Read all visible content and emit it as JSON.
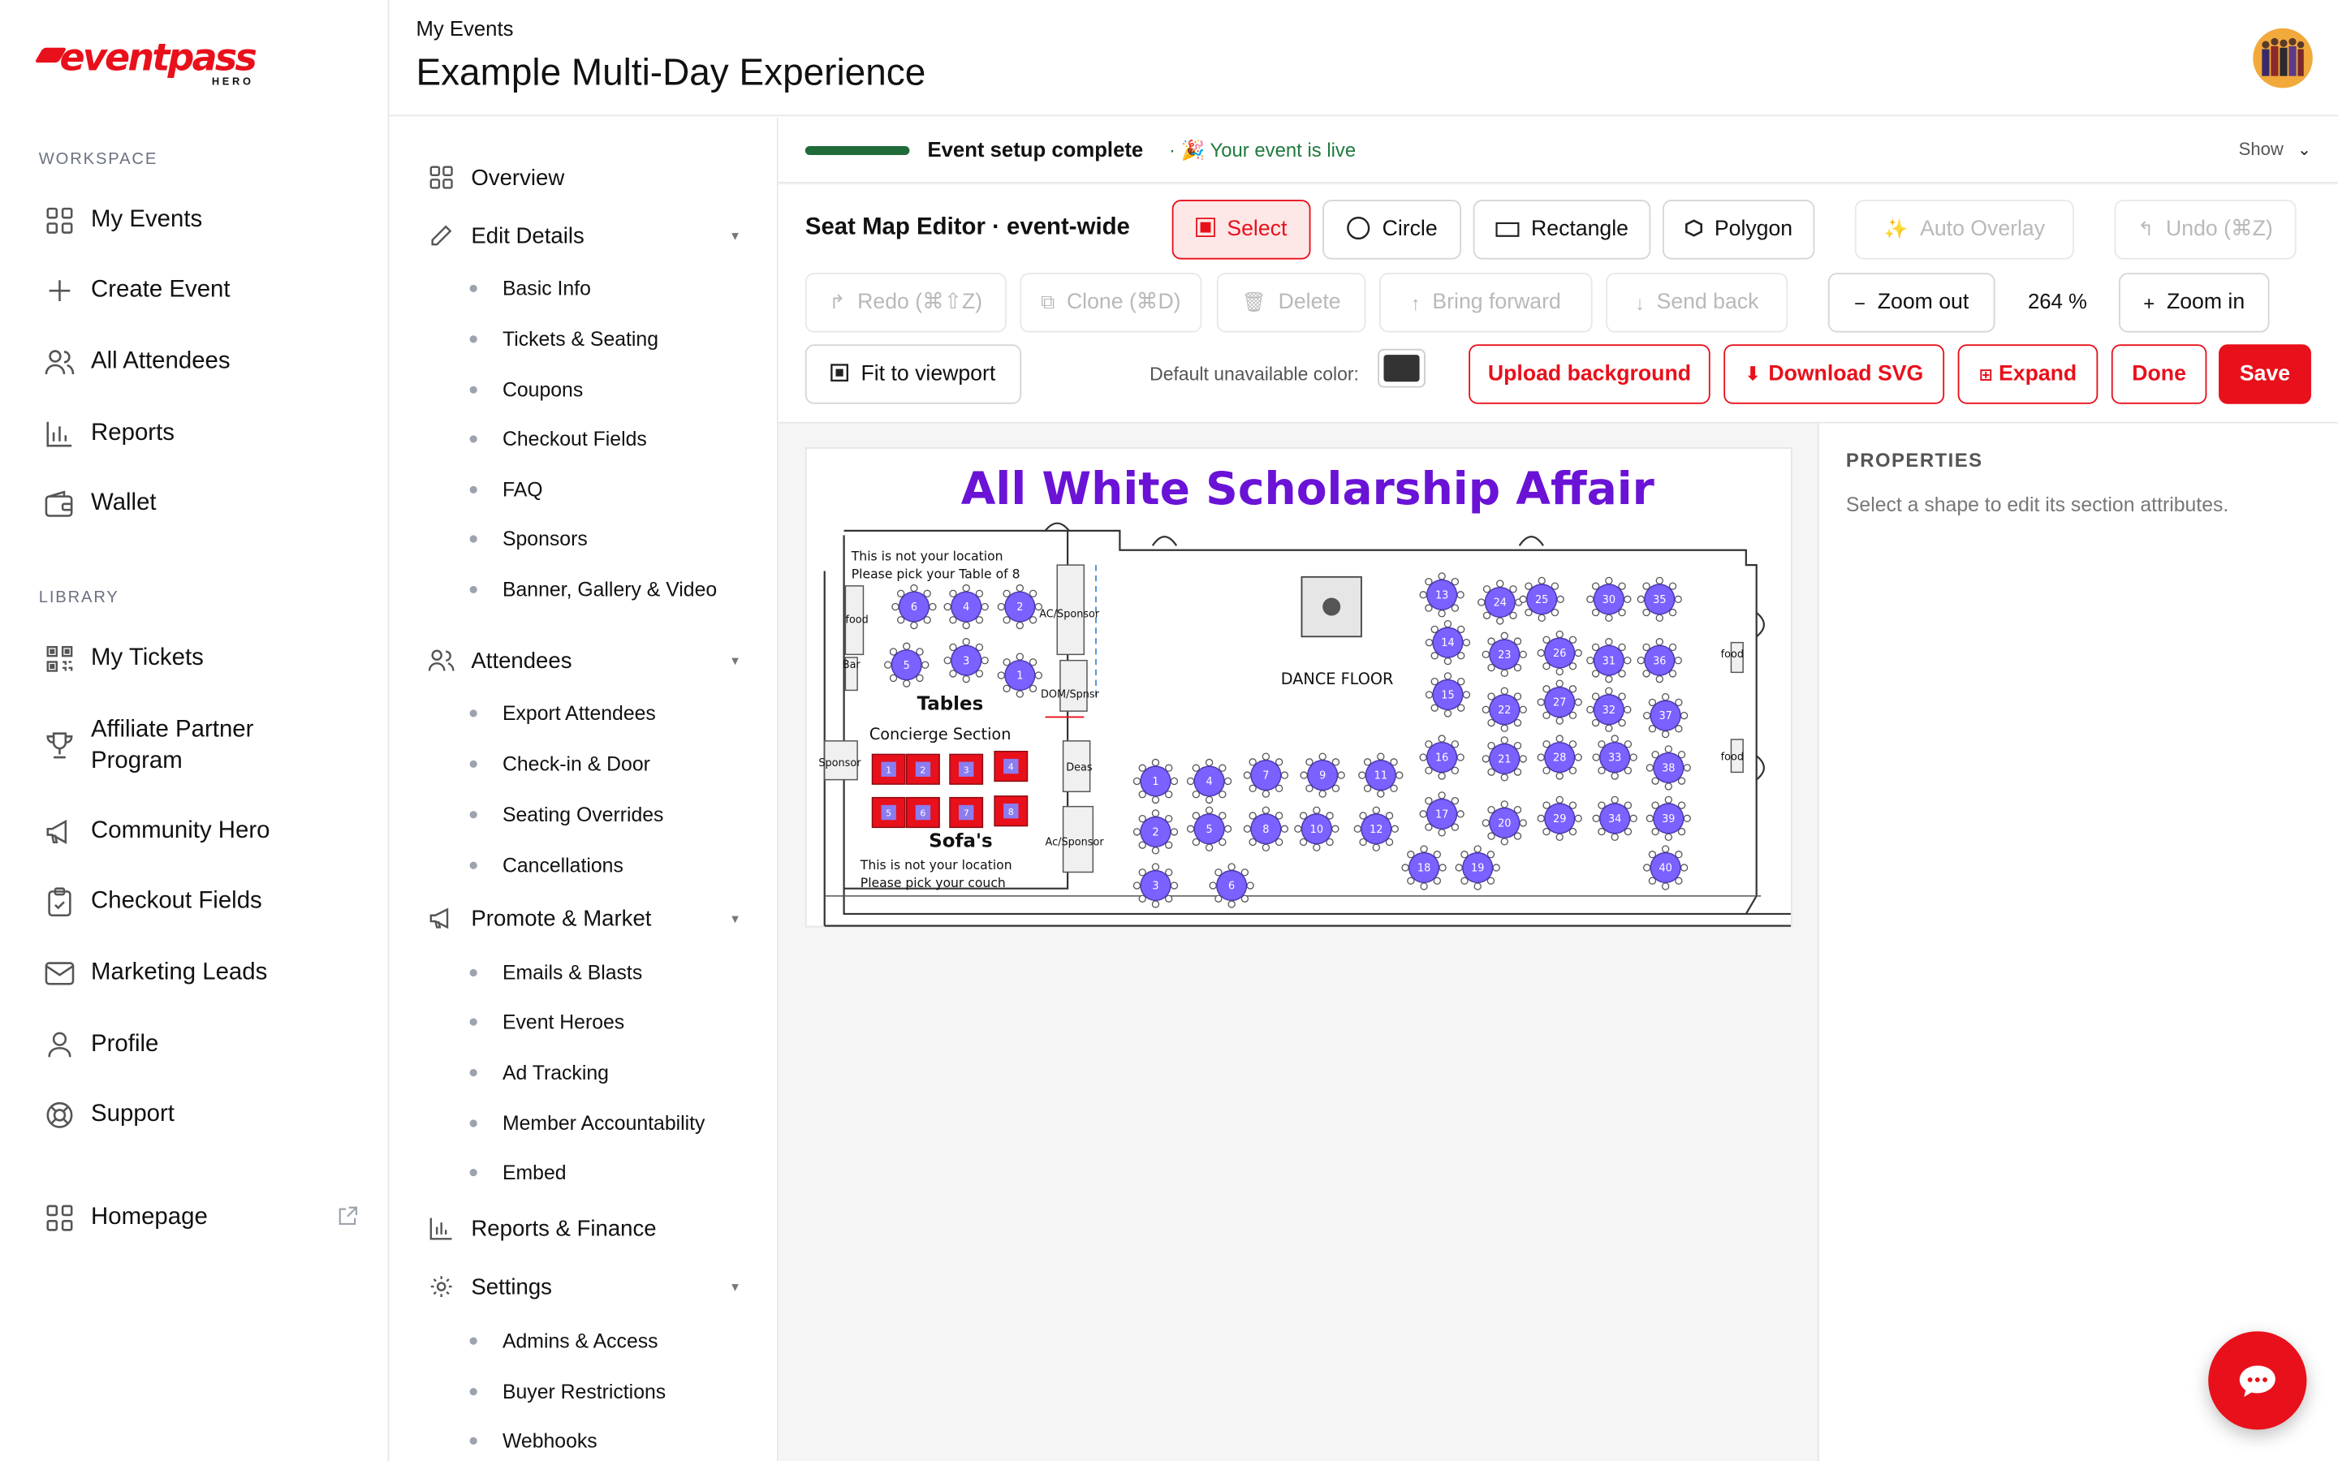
{
  "brand": {
    "logo_text": "eventpass",
    "logo_sub": "HERO",
    "accent": "#e8101b"
  },
  "sidebar": {
    "workspace_label": "WORKSPACE",
    "library_label": "LIBRARY",
    "workspace_items": [
      {
        "label": "My Events",
        "icon": "grid-icon"
      },
      {
        "label": "Create Event",
        "icon": "plus-icon"
      },
      {
        "label": "All Attendees",
        "icon": "users-icon"
      },
      {
        "label": "Reports",
        "icon": "bar-chart-icon"
      },
      {
        "label": "Wallet",
        "icon": "wallet-icon"
      }
    ],
    "library_items": [
      {
        "label": "My Tickets",
        "icon": "qr-code-icon"
      },
      {
        "label": "Affiliate Partner Program",
        "icon": "trophy-icon"
      },
      {
        "label": "Community Hero",
        "icon": "megaphone-icon"
      },
      {
        "label": "Checkout Fields",
        "icon": "clipboard-icon"
      },
      {
        "label": "Marketing Leads",
        "icon": "mail-icon"
      },
      {
        "label": "Profile",
        "icon": "user-icon"
      },
      {
        "label": "Support",
        "icon": "lifebuoy-icon"
      }
    ],
    "homepage": {
      "label": "Homepage",
      "icon": "grid-icon"
    }
  },
  "header": {
    "breadcrumb": "My Events",
    "title": "Example Multi-Day Experience"
  },
  "subnav": {
    "overview": "Overview",
    "edit_details": "Edit Details",
    "edit_items": [
      "Basic Info",
      "Tickets & Seating",
      "Coupons",
      "Checkout Fields",
      "FAQ",
      "Sponsors",
      "Banner, Gallery & Video"
    ],
    "attendees": "Attendees",
    "attendee_items": [
      "Export Attendees",
      "Check-in & Door",
      "Seating Overrides",
      "Cancellations"
    ],
    "promote": "Promote & Market",
    "promote_items": [
      "Emails & Blasts",
      "Event Heroes",
      "Ad Tracking",
      "Member Accountability",
      "Embed"
    ],
    "reports": "Reports & Finance",
    "settings": "Settings",
    "settings_items": [
      "Admins & Access",
      "Buyer Restrictions",
      "Webhooks"
    ]
  },
  "status": {
    "complete": "Event setup complete",
    "live": "· 🎉 Your event is live",
    "show": "Show"
  },
  "toolbar": {
    "title": "Seat Map Editor · event-wide",
    "select": "Select",
    "circle": "Circle",
    "rectangle": "Rectangle",
    "polygon": "Polygon",
    "auto_overlay": "Auto Overlay",
    "undo": "Undo (⌘Z)",
    "redo": "Redo (⌘⇧Z)",
    "clone": "Clone (⌘D)",
    "delete": "Delete",
    "bring_forward": "Bring forward",
    "send_back": "Send back",
    "zoom_out": "Zoom out",
    "zoom_value": "264  %",
    "zoom_in": "Zoom in",
    "fit": "Fit to viewport",
    "default_color_label": "Default unavailable color:",
    "default_color": "#333333",
    "upload_bg": "Upload background",
    "download_svg": "Download SVG",
    "expand": "Expand",
    "done": "Done",
    "save": "Save"
  },
  "seatmap": {
    "title": "All White Scholarship Affair",
    "note_top_line1": "This is not your location",
    "note_top_line2": "Please pick your Table of 8",
    "tables_label": "Tables",
    "concierge_label": "Concierge Section",
    "sofas_label": "Sofa's",
    "note_bottom_line1": "This is not your location",
    "note_bottom_line2": "Please pick your couch",
    "dance_floor": "DANCE FLOOR",
    "food": "food",
    "bar": "Bar",
    "sponsor": "Sponsor",
    "ac_sponsor_top": "AC/Sponsor",
    "dom_sponsor": "DOM/Spnsr",
    "deas": "Deas",
    "ac_sponsor_bottom": "Ac/Sponsor",
    "left_tables": [
      {
        "n": "6"
      },
      {
        "n": "4"
      },
      {
        "n": "2"
      },
      {
        "n": "5"
      },
      {
        "n": "3"
      },
      {
        "n": "1"
      }
    ],
    "tables": [
      {
        "n": "13"
      },
      {
        "n": "24"
      },
      {
        "n": "25"
      },
      {
        "n": "30"
      },
      {
        "n": "35"
      },
      {
        "n": "14"
      },
      {
        "n": "23"
      },
      {
        "n": "26"
      },
      {
        "n": "31"
      },
      {
        "n": "36"
      },
      {
        "n": "15"
      },
      {
        "n": "22"
      },
      {
        "n": "27"
      },
      {
        "n": "32"
      },
      {
        "n": "37"
      },
      {
        "n": "16"
      },
      {
        "n": "21"
      },
      {
        "n": "28"
      },
      {
        "n": "33"
      },
      {
        "n": "38"
      },
      {
        "n": "17"
      },
      {
        "n": "20"
      },
      {
        "n": "29"
      },
      {
        "n": "34"
      },
      {
        "n": "39"
      },
      {
        "n": "18"
      },
      {
        "n": "19"
      },
      {
        "n": "40"
      },
      {
        "n": "1"
      },
      {
        "n": "4"
      },
      {
        "n": "7"
      },
      {
        "n": "9"
      },
      {
        "n": "11"
      },
      {
        "n": "2"
      },
      {
        "n": "5"
      },
      {
        "n": "8"
      },
      {
        "n": "10"
      },
      {
        "n": "12"
      },
      {
        "n": "3"
      },
      {
        "n": "6"
      }
    ],
    "sofas": [
      "1",
      "2",
      "3",
      "4",
      "5",
      "6",
      "7",
      "8"
    ],
    "table_color": "#7b61ff",
    "sofa_color": "#e8101b"
  },
  "properties": {
    "title": "PROPERTIES",
    "hint": "Select a shape to edit its section attributes."
  }
}
